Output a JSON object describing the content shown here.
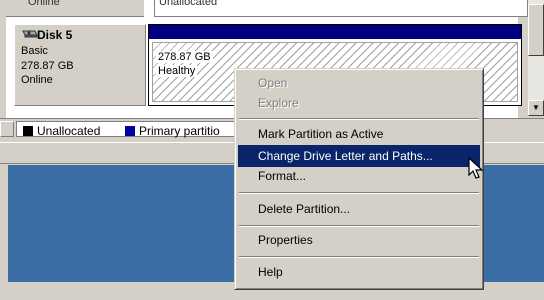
{
  "previous_row": {
    "status": "Online",
    "partition_label": "Unallocated"
  },
  "disk": {
    "name": "Disk 5",
    "type": "Basic",
    "size": "278.87 GB",
    "status": "Online",
    "partition_size": "278.87 GB",
    "partition_status": "Healthy"
  },
  "legend": {
    "items": [
      {
        "label": "Unallocated",
        "color": "#000000"
      },
      {
        "label": "Primary partitio",
        "color": "#0000a0"
      }
    ]
  },
  "context_menu": {
    "items": [
      {
        "label": "Open",
        "state": "disabled"
      },
      {
        "label": "Explore",
        "state": "disabled"
      },
      {
        "label": "Mark Partition as Active",
        "state": "normal"
      },
      {
        "label": "Change Drive Letter and Paths...",
        "state": "selected"
      },
      {
        "label": "Format...",
        "state": "normal"
      },
      {
        "label": "Delete Partition...",
        "state": "normal"
      },
      {
        "label": "Properties",
        "state": "normal"
      },
      {
        "label": "Help",
        "state": "normal"
      }
    ]
  },
  "colors": {
    "selection": "#0a246a",
    "partition_bar": "#000080",
    "desktop": "#3a6ea5",
    "window_face": "#d4d0c8"
  }
}
